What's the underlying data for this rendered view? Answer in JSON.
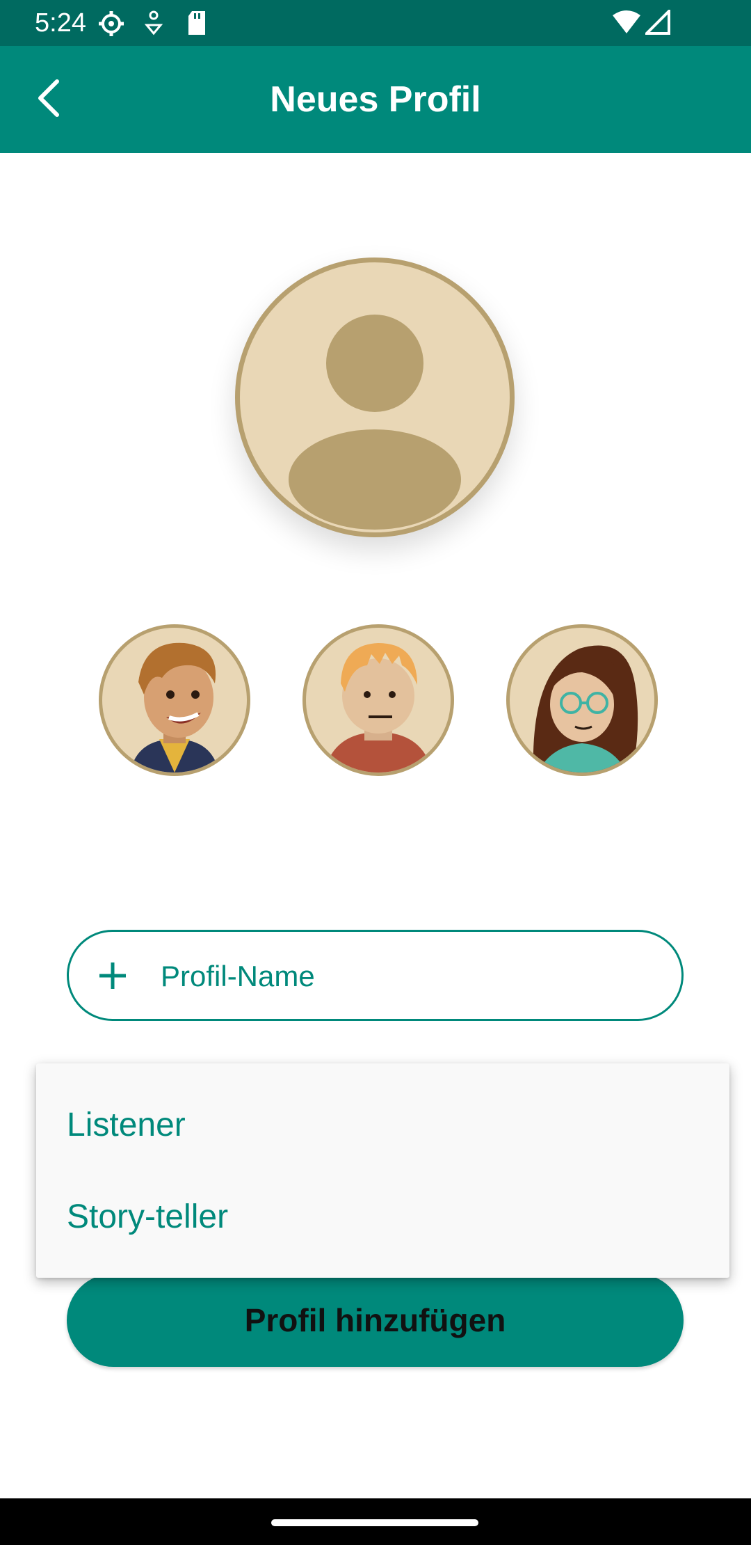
{
  "status_bar": {
    "time": "5:24",
    "icons": [
      "settings-icon",
      "notification-icon",
      "sd-card-icon",
      "wifi-icon",
      "signal-icon"
    ]
  },
  "app_bar": {
    "title": "Neues Profil",
    "back_icon": "chevron-left-icon"
  },
  "avatar": {
    "placeholder_icon": "person-icon",
    "options": [
      "avatar-boy-brown-hair",
      "avatar-boy-blond-hoodie",
      "avatar-girl-glasses"
    ]
  },
  "name_field": {
    "icon": "plus-icon",
    "placeholder": "Profil-Name",
    "value": ""
  },
  "role_dropdown": {
    "options": [
      {
        "label": "Listener"
      },
      {
        "label": "Story-teller"
      }
    ]
  },
  "actions": {
    "submit_label": "Profil hinzufügen"
  },
  "colors": {
    "accent": "#00897b",
    "status_bar": "#006a60",
    "avatar_bg": "#e9d7b6",
    "avatar_border": "#b7a06f"
  }
}
